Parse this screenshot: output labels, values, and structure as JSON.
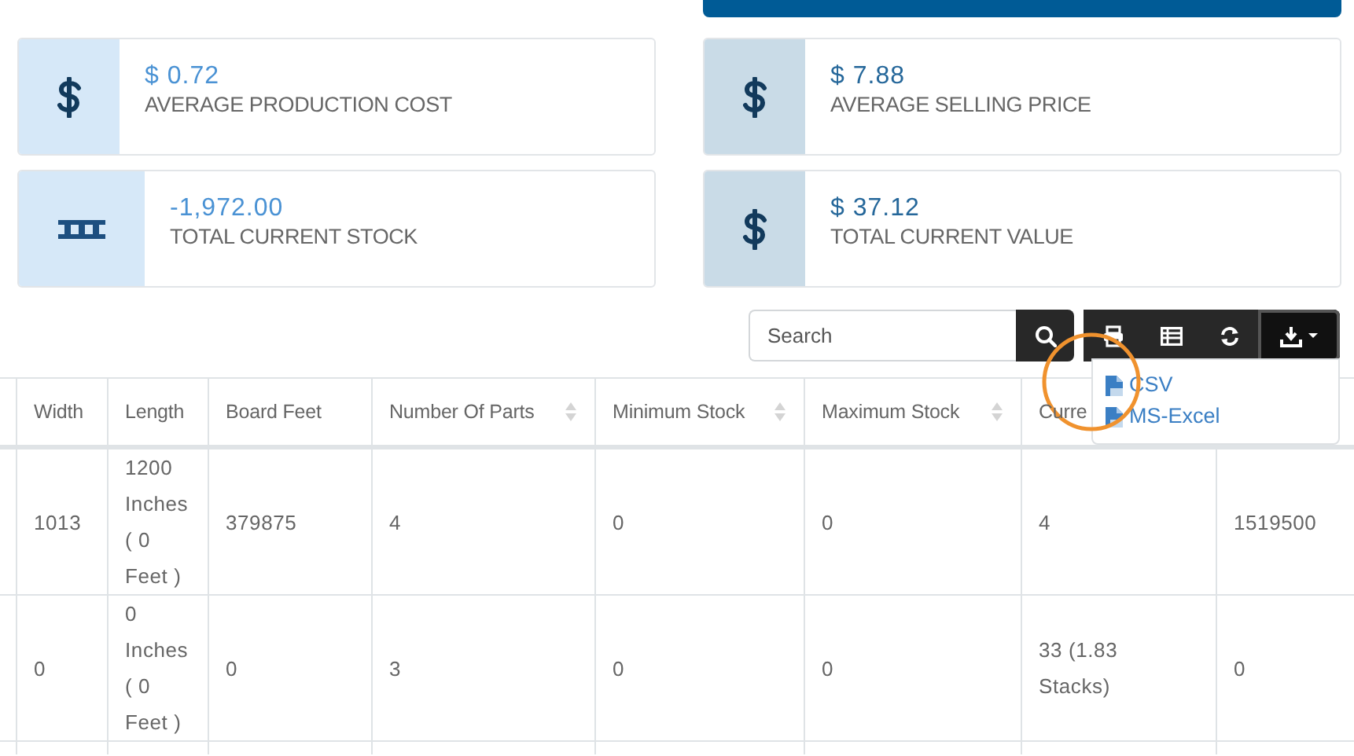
{
  "stats": [
    {
      "value": "$ 0.72",
      "label": "AVERAGE PRODUCTION COST",
      "kind": "money"
    },
    {
      "value": "$ 7.88",
      "label": "AVERAGE SELLING PRICE",
      "kind": "money"
    },
    {
      "value": "-1,972.00",
      "label": "TOTAL CURRENT STOCK",
      "kind": "stock"
    },
    {
      "value": "$ 37.12",
      "label": "TOTAL CURRENT VALUE",
      "kind": "money"
    }
  ],
  "toolbar": {
    "search": {
      "placeholder": "Search"
    },
    "buttons": [
      {
        "kind": "print"
      },
      {
        "kind": "table"
      },
      {
        "kind": "refresh"
      },
      {
        "kind": "export",
        "expanded": true
      }
    ],
    "export_menu": [
      {
        "label": "CSV"
      },
      {
        "label": "MS-Excel"
      }
    ]
  },
  "table": {
    "columns": [
      {
        "label": "Width",
        "sortable": false
      },
      {
        "label": "Length",
        "sortable": false
      },
      {
        "label": "Board Feet",
        "sortable": false
      },
      {
        "label": "Number Of Parts",
        "sortable": true
      },
      {
        "label": "Minimum Stock",
        "sortable": true
      },
      {
        "label": "Maximum Stock",
        "sortable": true
      },
      {
        "label": "Curre",
        "sortable": false
      }
    ],
    "rows": [
      [
        "1013",
        "1200 Inches ( 0 Feet )",
        "379875",
        "4",
        "0",
        "0",
        "4",
        "1519500"
      ],
      [
        "0",
        "0 Inches ( 0 Feet )",
        "0",
        "3",
        "0",
        "0",
        "33 (1.83 Stacks)",
        "0"
      ]
    ]
  }
}
